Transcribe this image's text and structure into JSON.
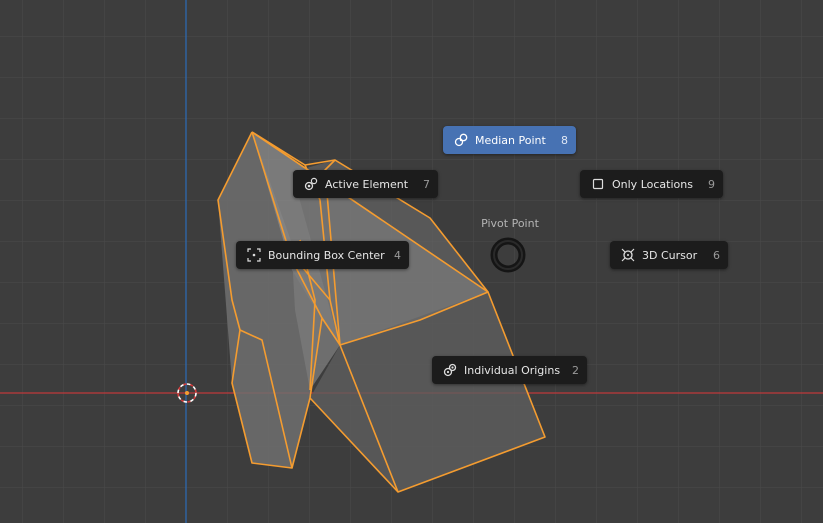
{
  "pie_menu": {
    "title": "Pivot Point",
    "items": [
      {
        "label": "Median Point",
        "shortcut": "8",
        "icon": "median-point-icon",
        "selected": true
      },
      {
        "label": "Active Element",
        "shortcut": "7",
        "icon": "active-element-icon"
      },
      {
        "label": "Only Locations",
        "shortcut": "9",
        "icon": "checkbox-icon"
      },
      {
        "label": "Bounding Box Center",
        "shortcut": "4",
        "icon": "bounding-box-icon"
      },
      {
        "label": "3D Cursor",
        "shortcut": "6",
        "icon": "3d-cursor-icon"
      },
      {
        "label": "Individual Origins",
        "shortcut": "2",
        "icon": "individual-origins-icon"
      }
    ]
  },
  "colors": {
    "background": "#3d3d3d",
    "grid": "#494949",
    "x_axis": "#c0393b",
    "y_axis": "#2b6cb8",
    "selection_outline": "#f49c30",
    "menu_item": "#1c1c1c",
    "menu_active": "#4772b3"
  }
}
